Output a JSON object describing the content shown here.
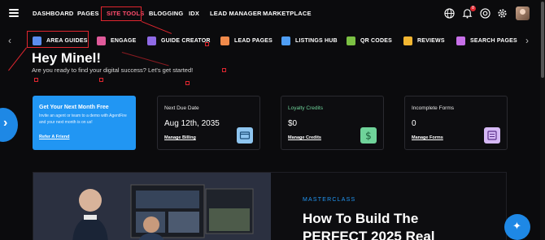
{
  "topnav": {
    "items": [
      {
        "label": "DASHBOARD"
      },
      {
        "label": "PAGES"
      },
      {
        "label": "SITE TOOLS"
      },
      {
        "label": "BLOGGING"
      },
      {
        "label": "IDX"
      },
      {
        "label": "LEAD MANAGER"
      },
      {
        "label": "MARKETPLACE"
      }
    ],
    "notification_count": "8",
    "icons": [
      "globe-icon",
      "bell-icon",
      "support-icon",
      "gear-icon"
    ]
  },
  "subnav": {
    "items": [
      {
        "label": "AREA GUIDES",
        "color": "#5b8def"
      },
      {
        "label": "ENGAGE",
        "color": "#e05a9a"
      },
      {
        "label": "GUIDE CREATOR",
        "color": "#8f6ae6"
      },
      {
        "label": "LEAD PAGES",
        "color": "#f08a4b"
      },
      {
        "label": "LISTINGS HUB",
        "color": "#4f9ef5"
      },
      {
        "label": "QR CODES",
        "color": "#7bc043"
      },
      {
        "label": "REVIEWS",
        "color": "#f2b632"
      },
      {
        "label": "SEARCH PAGES",
        "color": "#c770e8"
      }
    ]
  },
  "greeting": {
    "title": "Hey Minel!",
    "subtitle": "Are you ready to find your digital success? Let's get started!"
  },
  "cards": {
    "promo": {
      "title": "Get Your Next Month Free",
      "description": "Invite an agent or team to a demo with AgentFire and your next month is on us!",
      "link": "Refer A Friend"
    },
    "due": {
      "title": "Next Due Date",
      "value": "Aug 12th, 2035",
      "link": "Manage Billing",
      "icon_color": "#8ec5f0"
    },
    "credits": {
      "title": "Loyalty Credits",
      "value": "$0",
      "link": "Manage Credits",
      "icon_color": "#6fd39a"
    },
    "forms": {
      "title": "Incomplete Forms",
      "value": "0",
      "link": "Manage Forms",
      "icon_color": "#d5b8f5"
    }
  },
  "banner": {
    "tag": "MASTERCLASS",
    "title": "How To Build The PERFECT 2025 Real"
  }
}
